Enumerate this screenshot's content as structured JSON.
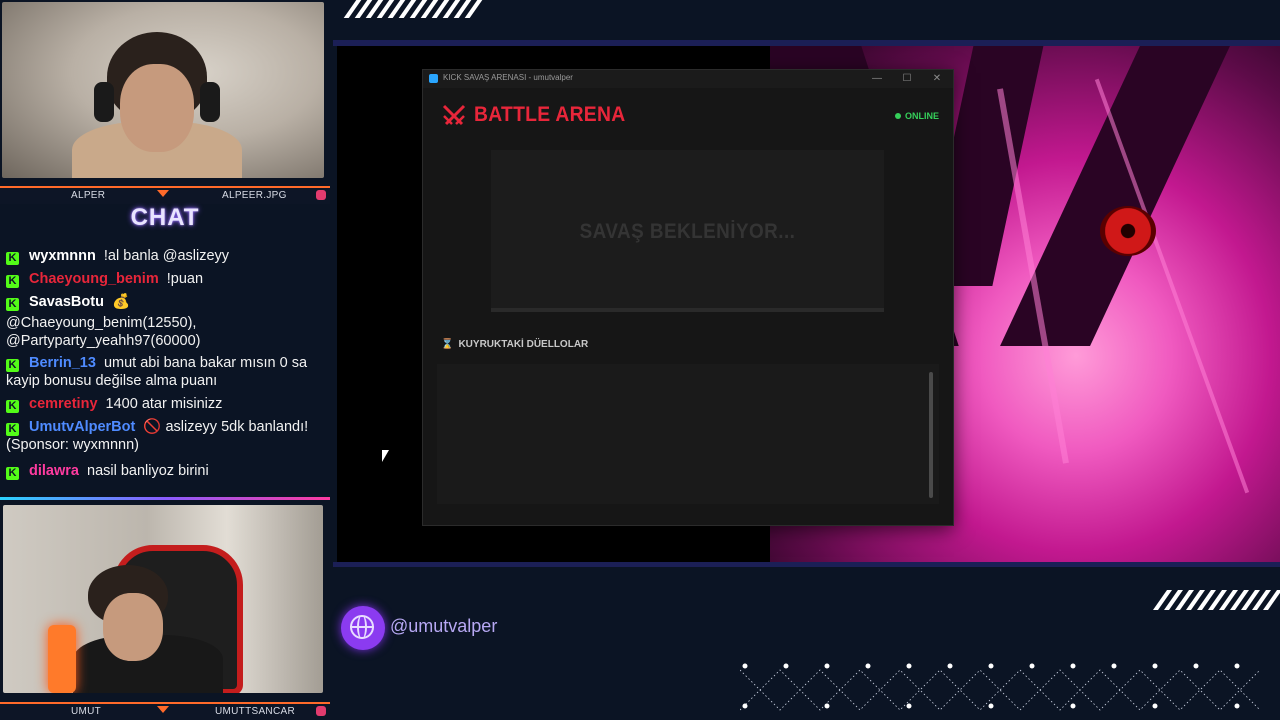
{
  "webcams": {
    "top": {
      "left_name": "ALPER",
      "right_name": "ALPEER.JPG"
    },
    "bottom": {
      "left_name": "UMUT",
      "right_name": "UMUTTSANCAR"
    }
  },
  "chat": {
    "title": "CHAT",
    "messages": [
      {
        "user": "wyxmnnn",
        "user_color": "#ffffff",
        "text": "!al banla @aslizeyy"
      },
      {
        "user": "Chaeyoung_benim",
        "user_color": "#e8263a",
        "text": "!puan"
      },
      {
        "user": "SavasBotu",
        "user_color": "#ffffff",
        "badge": "💰",
        "text": "@Chaeyoung_benim(12550), @Partyparty_yeahh97(60000)"
      },
      {
        "user": "Berrin_13",
        "user_color": "#4f8bff",
        "text": "umut abi bana bakar mısın 0 sa kayip bonusu değilse alma puanı"
      },
      {
        "user": "cemretiny",
        "user_color": "#e8263a",
        "text": "1400 atar misinizz"
      },
      {
        "user": "UmutvAlperBot",
        "user_color": "#4f8bff",
        "badge": "🚫",
        "text": "aslizeyy 5dk banlandı! (Sponsor: wyxmnnn)"
      },
      {
        "user": "dilawra",
        "user_color": "#ff3ba0",
        "text": "nasil banliyoz birini"
      }
    ]
  },
  "window": {
    "title": "KICK SAVAŞ ARENASI - umutvalper",
    "controls": {
      "minimize": "—",
      "maximize": "☐",
      "close": "✕"
    },
    "header": {
      "title": "BATTLE ARENA",
      "icon": "crossed-swords-icon"
    },
    "status": "ONLINE",
    "arena_status": "SAVAŞ BEKLENİYOR...",
    "queue": {
      "title": "KUYRUKTAKİ DÜELLOLAR",
      "icon": "hourglass-icon",
      "items": []
    }
  },
  "social": {
    "handle": "@umutvalper",
    "icon": "globe-icon"
  },
  "colors": {
    "accent_red": "#e8263a",
    "online_green": "#35d05a",
    "kick_green": "#53fc18",
    "brand_purple": "#8b3bf0"
  }
}
